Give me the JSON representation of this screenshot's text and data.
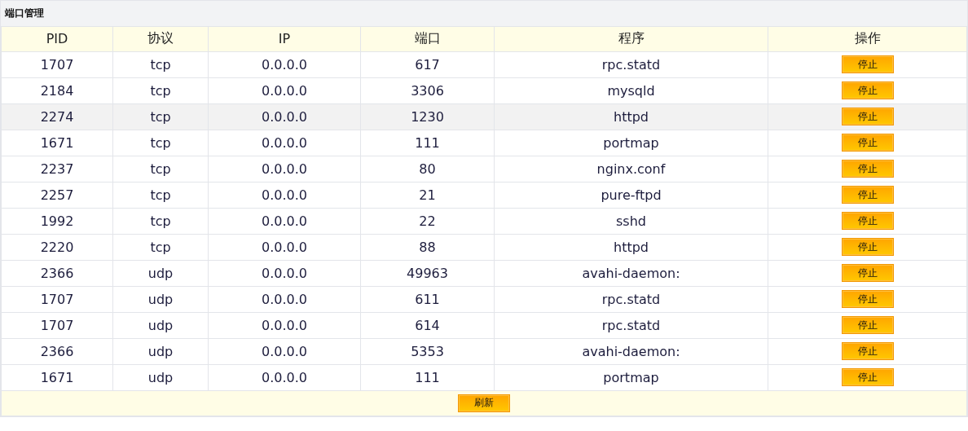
{
  "panel": {
    "title": "端口管理"
  },
  "table": {
    "columns": [
      "PID",
      "协议",
      "IP",
      "端口",
      "程序",
      "操作"
    ],
    "rows": [
      {
        "pid": "1707",
        "protocol": "tcp",
        "ip": "0.0.0.0",
        "port": "617",
        "program": "rpc.statd",
        "action": "停止",
        "selected": false
      },
      {
        "pid": "2184",
        "protocol": "tcp",
        "ip": "0.0.0.0",
        "port": "3306",
        "program": "mysqld",
        "action": "停止",
        "selected": false
      },
      {
        "pid": "2274",
        "protocol": "tcp",
        "ip": "0.0.0.0",
        "port": "1230",
        "program": "httpd",
        "action": "停止",
        "selected": true
      },
      {
        "pid": "1671",
        "protocol": "tcp",
        "ip": "0.0.0.0",
        "port": "111",
        "program": "portmap",
        "action": "停止",
        "selected": false
      },
      {
        "pid": "2237",
        "protocol": "tcp",
        "ip": "0.0.0.0",
        "port": "80",
        "program": "nginx.conf",
        "action": "停止",
        "selected": false
      },
      {
        "pid": "2257",
        "protocol": "tcp",
        "ip": "0.0.0.0",
        "port": "21",
        "program": "pure-ftpd",
        "action": "停止",
        "selected": false
      },
      {
        "pid": "1992",
        "protocol": "tcp",
        "ip": "0.0.0.0",
        "port": "22",
        "program": "sshd",
        "action": "停止",
        "selected": false
      },
      {
        "pid": "2220",
        "protocol": "tcp",
        "ip": "0.0.0.0",
        "port": "88",
        "program": "httpd",
        "action": "停止",
        "selected": false
      },
      {
        "pid": "2366",
        "protocol": "udp",
        "ip": "0.0.0.0",
        "port": "49963",
        "program": "avahi-daemon:",
        "action": "停止",
        "selected": false
      },
      {
        "pid": "1707",
        "protocol": "udp",
        "ip": "0.0.0.0",
        "port": "611",
        "program": "rpc.statd",
        "action": "停止",
        "selected": false
      },
      {
        "pid": "1707",
        "protocol": "udp",
        "ip": "0.0.0.0",
        "port": "614",
        "program": "rpc.statd",
        "action": "停止",
        "selected": false
      },
      {
        "pid": "2366",
        "protocol": "udp",
        "ip": "0.0.0.0",
        "port": "5353",
        "program": "avahi-daemon:",
        "action": "停止",
        "selected": false
      },
      {
        "pid": "1671",
        "protocol": "udp",
        "ip": "0.0.0.0",
        "port": "111",
        "program": "portmap",
        "action": "停止",
        "selected": false
      }
    ],
    "footer_button": "刷新"
  }
}
